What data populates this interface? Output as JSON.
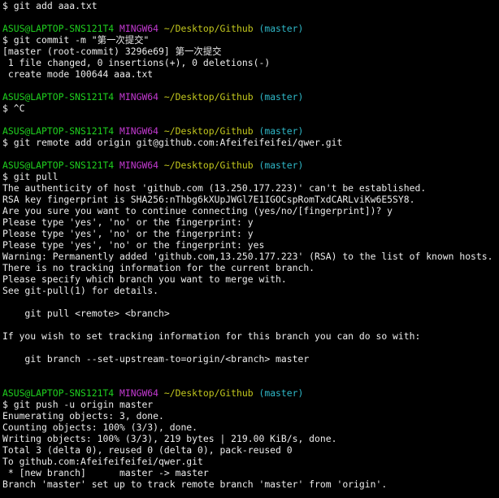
{
  "terminal": {
    "colors": {
      "background": "#000000",
      "text": "#ececec",
      "user_host": "#1fd21f",
      "system": "#c43ad2",
      "path": "#c3c81e",
      "branch": "#2fb8c8"
    },
    "lines": [
      {
        "kind": "command",
        "text": "$ git add aaa.txt"
      },
      {
        "kind": "blank",
        "text": ""
      },
      {
        "kind": "prompt",
        "user_host": "ASUS@LAPTOP-SNS121T4",
        "system": "MINGW64",
        "path": "~/Desktop/Github",
        "branch": "(master)"
      },
      {
        "kind": "command",
        "text": "$ git commit -m \"第一次提交\""
      },
      {
        "kind": "output",
        "text": "[master (root-commit) 3296e69] 第一次提交"
      },
      {
        "kind": "output",
        "text": " 1 file changed, 0 insertions(+), 0 deletions(-)"
      },
      {
        "kind": "output",
        "text": " create mode 100644 aaa.txt"
      },
      {
        "kind": "blank",
        "text": ""
      },
      {
        "kind": "prompt",
        "user_host": "ASUS@LAPTOP-SNS121T4",
        "system": "MINGW64",
        "path": "~/Desktop/Github",
        "branch": "(master)"
      },
      {
        "kind": "command",
        "text": "$ ^C"
      },
      {
        "kind": "blank",
        "text": ""
      },
      {
        "kind": "prompt",
        "user_host": "ASUS@LAPTOP-SNS121T4",
        "system": "MINGW64",
        "path": "~/Desktop/Github",
        "branch": "(master)"
      },
      {
        "kind": "command",
        "text": "$ git remote add origin git@github.com:Afeifeifeifei/qwer.git"
      },
      {
        "kind": "blank",
        "text": ""
      },
      {
        "kind": "prompt",
        "user_host": "ASUS@LAPTOP-SNS121T4",
        "system": "MINGW64",
        "path": "~/Desktop/Github",
        "branch": "(master)"
      },
      {
        "kind": "command",
        "text": "$ git pull"
      },
      {
        "kind": "output",
        "text": "The authenticity of host 'github.com (13.250.177.223)' can't be established."
      },
      {
        "kind": "output",
        "text": "RSA key fingerprint is SHA256:nThbg6kXUpJWGl7E1IGOCspRomTxdCARLviKw6E5SY8."
      },
      {
        "kind": "output",
        "text": "Are you sure you want to continue connecting (yes/no/[fingerprint])? y"
      },
      {
        "kind": "output",
        "text": "Please type 'yes', 'no' or the fingerprint: y"
      },
      {
        "kind": "output",
        "text": "Please type 'yes', 'no' or the fingerprint: y"
      },
      {
        "kind": "output",
        "text": "Please type 'yes', 'no' or the fingerprint: yes"
      },
      {
        "kind": "output",
        "text": "Warning: Permanently added 'github.com,13.250.177.223' (RSA) to the list of known hosts."
      },
      {
        "kind": "output",
        "text": "There is no tracking information for the current branch."
      },
      {
        "kind": "output",
        "text": "Please specify which branch you want to merge with."
      },
      {
        "kind": "output",
        "text": "See git-pull(1) for details."
      },
      {
        "kind": "blank",
        "text": ""
      },
      {
        "kind": "output",
        "text": "    git pull <remote> <branch>"
      },
      {
        "kind": "blank",
        "text": ""
      },
      {
        "kind": "output",
        "text": "If you wish to set tracking information for this branch you can do so with:"
      },
      {
        "kind": "blank",
        "text": ""
      },
      {
        "kind": "output",
        "text": "    git branch --set-upstream-to=origin/<branch> master"
      },
      {
        "kind": "blank",
        "text": ""
      },
      {
        "kind": "blank",
        "text": ""
      },
      {
        "kind": "prompt",
        "user_host": "ASUS@LAPTOP-SNS121T4",
        "system": "MINGW64",
        "path": "~/Desktop/Github",
        "branch": "(master)"
      },
      {
        "kind": "command",
        "text": "$ git push -u origin master"
      },
      {
        "kind": "output",
        "text": "Enumerating objects: 3, done."
      },
      {
        "kind": "output",
        "text": "Counting objects: 100% (3/3), done."
      },
      {
        "kind": "output",
        "text": "Writing objects: 100% (3/3), 219 bytes | 219.00 KiB/s, done."
      },
      {
        "kind": "output",
        "text": "Total 3 (delta 0), reused 0 (delta 0), pack-reused 0"
      },
      {
        "kind": "output",
        "text": "To github.com:Afeifeifeifei/qwer.git"
      },
      {
        "kind": "output",
        "text": " * [new branch]      master -> master"
      },
      {
        "kind": "output",
        "text": "Branch 'master' set up to track remote branch 'master' from 'origin'."
      }
    ]
  }
}
